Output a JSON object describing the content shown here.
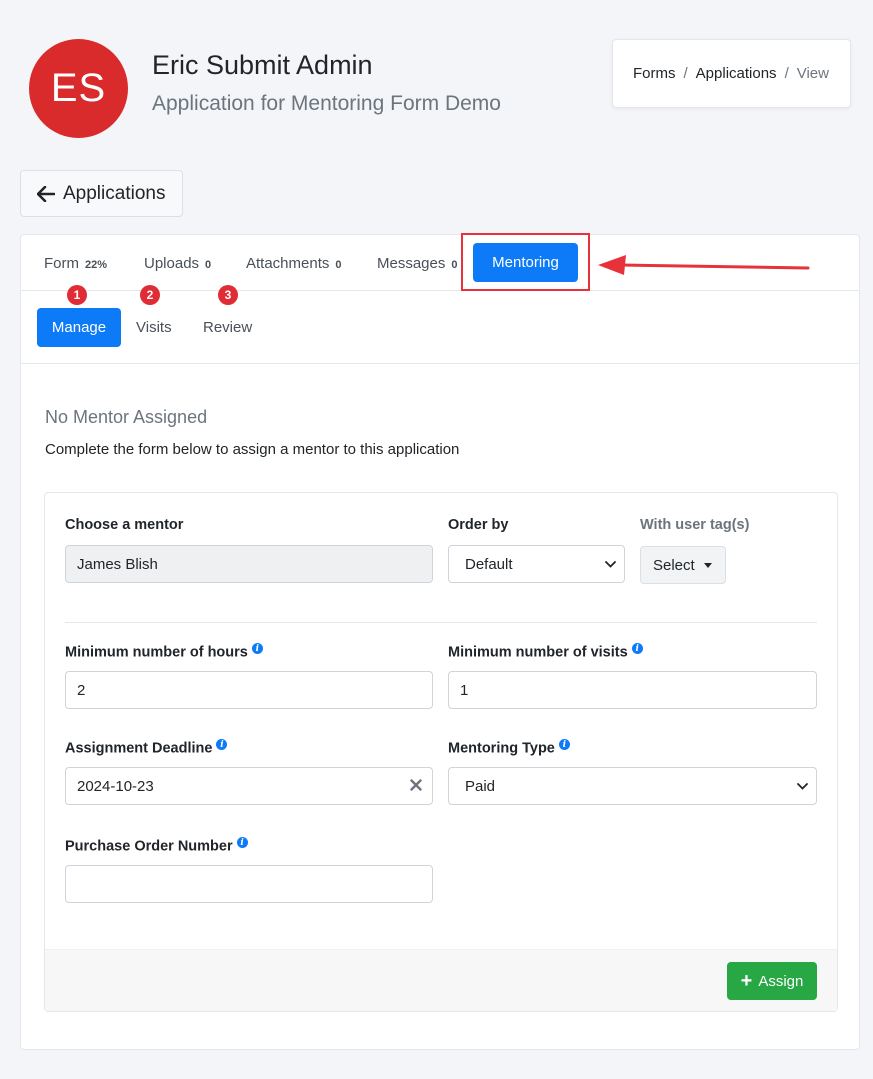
{
  "header": {
    "avatar_initials": "ES",
    "avatar_color": "#d92b2b",
    "user_name": "Eric Submit Admin",
    "subtitle": "Application for Mentoring Form Demo"
  },
  "breadcrumb": {
    "items": [
      "Forms",
      "Applications"
    ],
    "separator": "/",
    "current": "View"
  },
  "back_button": {
    "label": "Applications",
    "icon": "arrow-left-icon"
  },
  "tabs": [
    {
      "label": "Form",
      "count": "22%"
    },
    {
      "label": "Uploads",
      "count": "0"
    },
    {
      "label": "Attachments",
      "count": "0"
    },
    {
      "label": "Messages",
      "count": "0"
    },
    {
      "label": "Mentoring",
      "count": "",
      "active": true
    }
  ],
  "subtabs": [
    {
      "label": "Manage",
      "badge": "1",
      "active": true
    },
    {
      "label": "Visits",
      "badge": "2"
    },
    {
      "label": "Review",
      "badge": "3"
    }
  ],
  "mentor_section": {
    "title": "No Mentor Assigned",
    "instructions": "Complete the form below to assign a mentor to this application"
  },
  "form": {
    "choose_mentor": {
      "label": "Choose a mentor",
      "value": "James Blish"
    },
    "order_by": {
      "label": "Order by",
      "value": "Default"
    },
    "user_tags": {
      "label": "With user tag(s)",
      "button": "Select"
    },
    "min_hours": {
      "label": "Minimum number of hours",
      "value": "2"
    },
    "min_visits": {
      "label": "Minimum number of visits",
      "value": "1"
    },
    "deadline": {
      "label": "Assignment Deadline",
      "value": "2024-10-23"
    },
    "mentoring_type": {
      "label": "Mentoring Type",
      "value": "Paid"
    },
    "po_number": {
      "label": "Purchase Order Number",
      "value": ""
    },
    "info_glyph": "i",
    "assign_button": "Assign"
  },
  "colors": {
    "primary": "#0d7bf7",
    "success": "#28a745",
    "danger": "#e02d35",
    "annotation": "#e8323a"
  }
}
